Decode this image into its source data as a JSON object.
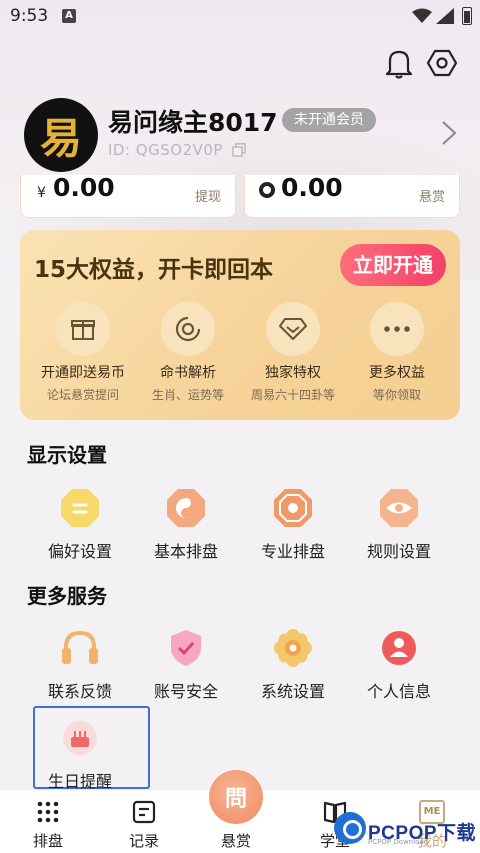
{
  "status_bar": {
    "time": "9:53",
    "notification_glyph": "A"
  },
  "header": {
    "icons": [
      "bell-icon",
      "gear-icon"
    ]
  },
  "profile": {
    "avatar_glyph": "易",
    "username": "易问缘主8017",
    "member_badge": "未开通会员",
    "user_id": "ID: QGSO2V0P"
  },
  "wallet": {
    "balance_currency": "¥",
    "balance_value": "0.00",
    "balance_action": "提现",
    "reward_value": "0.00",
    "reward_action": "悬赏"
  },
  "vip": {
    "title": "15大权益，开卡即回本",
    "button": "立即开通",
    "items": [
      {
        "title": "开通即送易币",
        "subtitle": "论坛悬赏提问",
        "icon": "gift-icon"
      },
      {
        "title": "命书解析",
        "subtitle": "生肖、运势等",
        "icon": "target-icon"
      },
      {
        "title": "独家特权",
        "subtitle": "周易六十四卦等",
        "icon": "diamond-icon"
      },
      {
        "title": "更多权益",
        "subtitle": "等你领取",
        "icon": "more-icon"
      }
    ]
  },
  "display_settings": {
    "title": "显示设置",
    "items": [
      {
        "label": "偏好设置",
        "icon": "preference-icon"
      },
      {
        "label": "基本排盘",
        "icon": "taiji-icon"
      },
      {
        "label": "专业排盘",
        "icon": "bagua-icon"
      },
      {
        "label": "规则设置",
        "icon": "eye-icon"
      }
    ]
  },
  "more_services": {
    "title": "更多服务",
    "items": [
      {
        "label": "联系反馈",
        "icon": "headset-icon"
      },
      {
        "label": "账号安全",
        "icon": "shield-icon"
      },
      {
        "label": "系统设置",
        "icon": "flower-gear-icon"
      },
      {
        "label": "个人信息",
        "icon": "person-icon"
      },
      {
        "label": "生日提醒",
        "icon": "cake-icon"
      }
    ]
  },
  "bottom_nav": {
    "items": [
      {
        "label": "排盘",
        "icon": "grid-dots-icon"
      },
      {
        "label": "记录",
        "icon": "record-icon"
      },
      {
        "label": "悬赏",
        "icon": "ask-icon",
        "glyph": "問"
      },
      {
        "label": "学堂",
        "icon": "book-icon"
      },
      {
        "label": "我的",
        "icon": "me-icon",
        "glyph": "ME"
      }
    ]
  },
  "watermark": {
    "text": "PCPOP下载",
    "sub": "PCPOP Download"
  },
  "colors": {
    "accent_red": "#f2406a",
    "vip_gold": "#f6d39a",
    "orange": "#ef8a64",
    "selection_blue": "#3d6fd6"
  }
}
